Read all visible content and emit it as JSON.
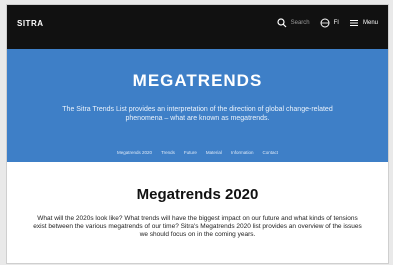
{
  "header": {
    "logo": "SITRA",
    "search_label": "Search",
    "lang_label": "FI",
    "menu_label": "Menu"
  },
  "hero": {
    "title": "MEGATRENDS",
    "description": "The Sitra Trends List provides an interpretation of the direction of global change-related phenomena – what are known as megatrends.",
    "nav": [
      "Megatrends 2020",
      "Trends",
      "Future",
      "Material",
      "Information",
      "Contact"
    ]
  },
  "content": {
    "title": "Megatrends 2020",
    "intro": "What will the 2020s look like? What trends will have the biggest impact on our future and what kinds of tensions exist between the various megatrends of our time? Sitra's Megatrends 2020 list provides an overview of the issues we should focus on in the coming years."
  },
  "colors": {
    "topbar": "#111111",
    "hero": "#3e7fc7"
  }
}
